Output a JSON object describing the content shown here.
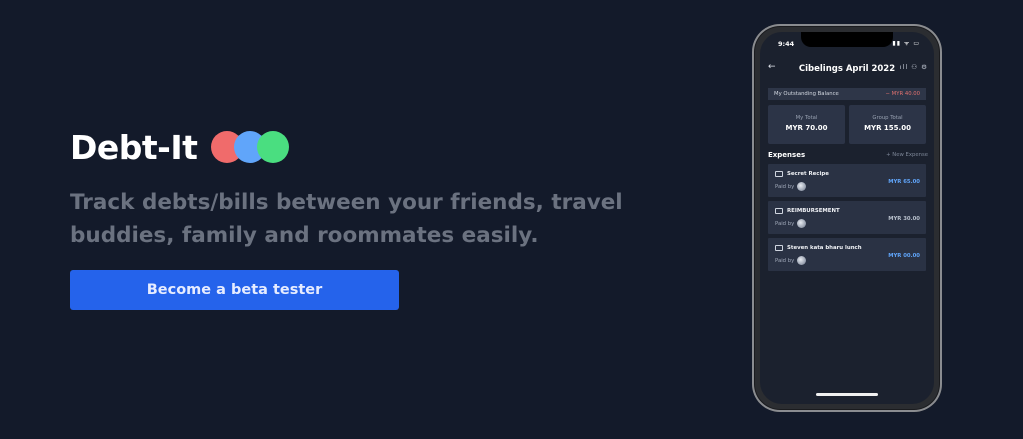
{
  "brand": {
    "title": "Debt-It",
    "dot_colors": [
      "#f06b6b",
      "#60a5fa",
      "#4ade80"
    ]
  },
  "hero": {
    "tagline": "Track debts/bills between your friends, travel buddies, family and roommates easily.",
    "cta_label": "Become a beta tester"
  },
  "phone": {
    "status_time": "9:44",
    "status_icons": "▮▮ ᯤ ▭",
    "back_icon": "←",
    "group_title": "Cibelings April 2022",
    "nav_icons": "ıll ⚇ ⚙",
    "balance": {
      "label": "My Outstanding Balance",
      "value": "− MYR 40.00"
    },
    "totals": [
      {
        "label": "My Total",
        "value": "MYR 70.00"
      },
      {
        "label": "Group Total",
        "value": "MYR 155.00"
      }
    ],
    "expenses_title": "Expenses",
    "new_expense_label": "+ New Expense",
    "paid_by_label": "Paid by",
    "expenses": [
      {
        "name": "Secret Recipe",
        "amount": "MYR 65.00",
        "amount_color": "#60a5fa"
      },
      {
        "name": "REIMBURSEMENT",
        "amount": "MYR 30.00",
        "amount_color": "#b8c0cc"
      },
      {
        "name": "Steven kata bharu lunch",
        "amount": "MYR 00.00",
        "amount_color": "#60a5fa"
      }
    ]
  },
  "colors": {
    "background": "#131a2a",
    "cta": "#2563eb",
    "tagline": "#6b7280"
  }
}
